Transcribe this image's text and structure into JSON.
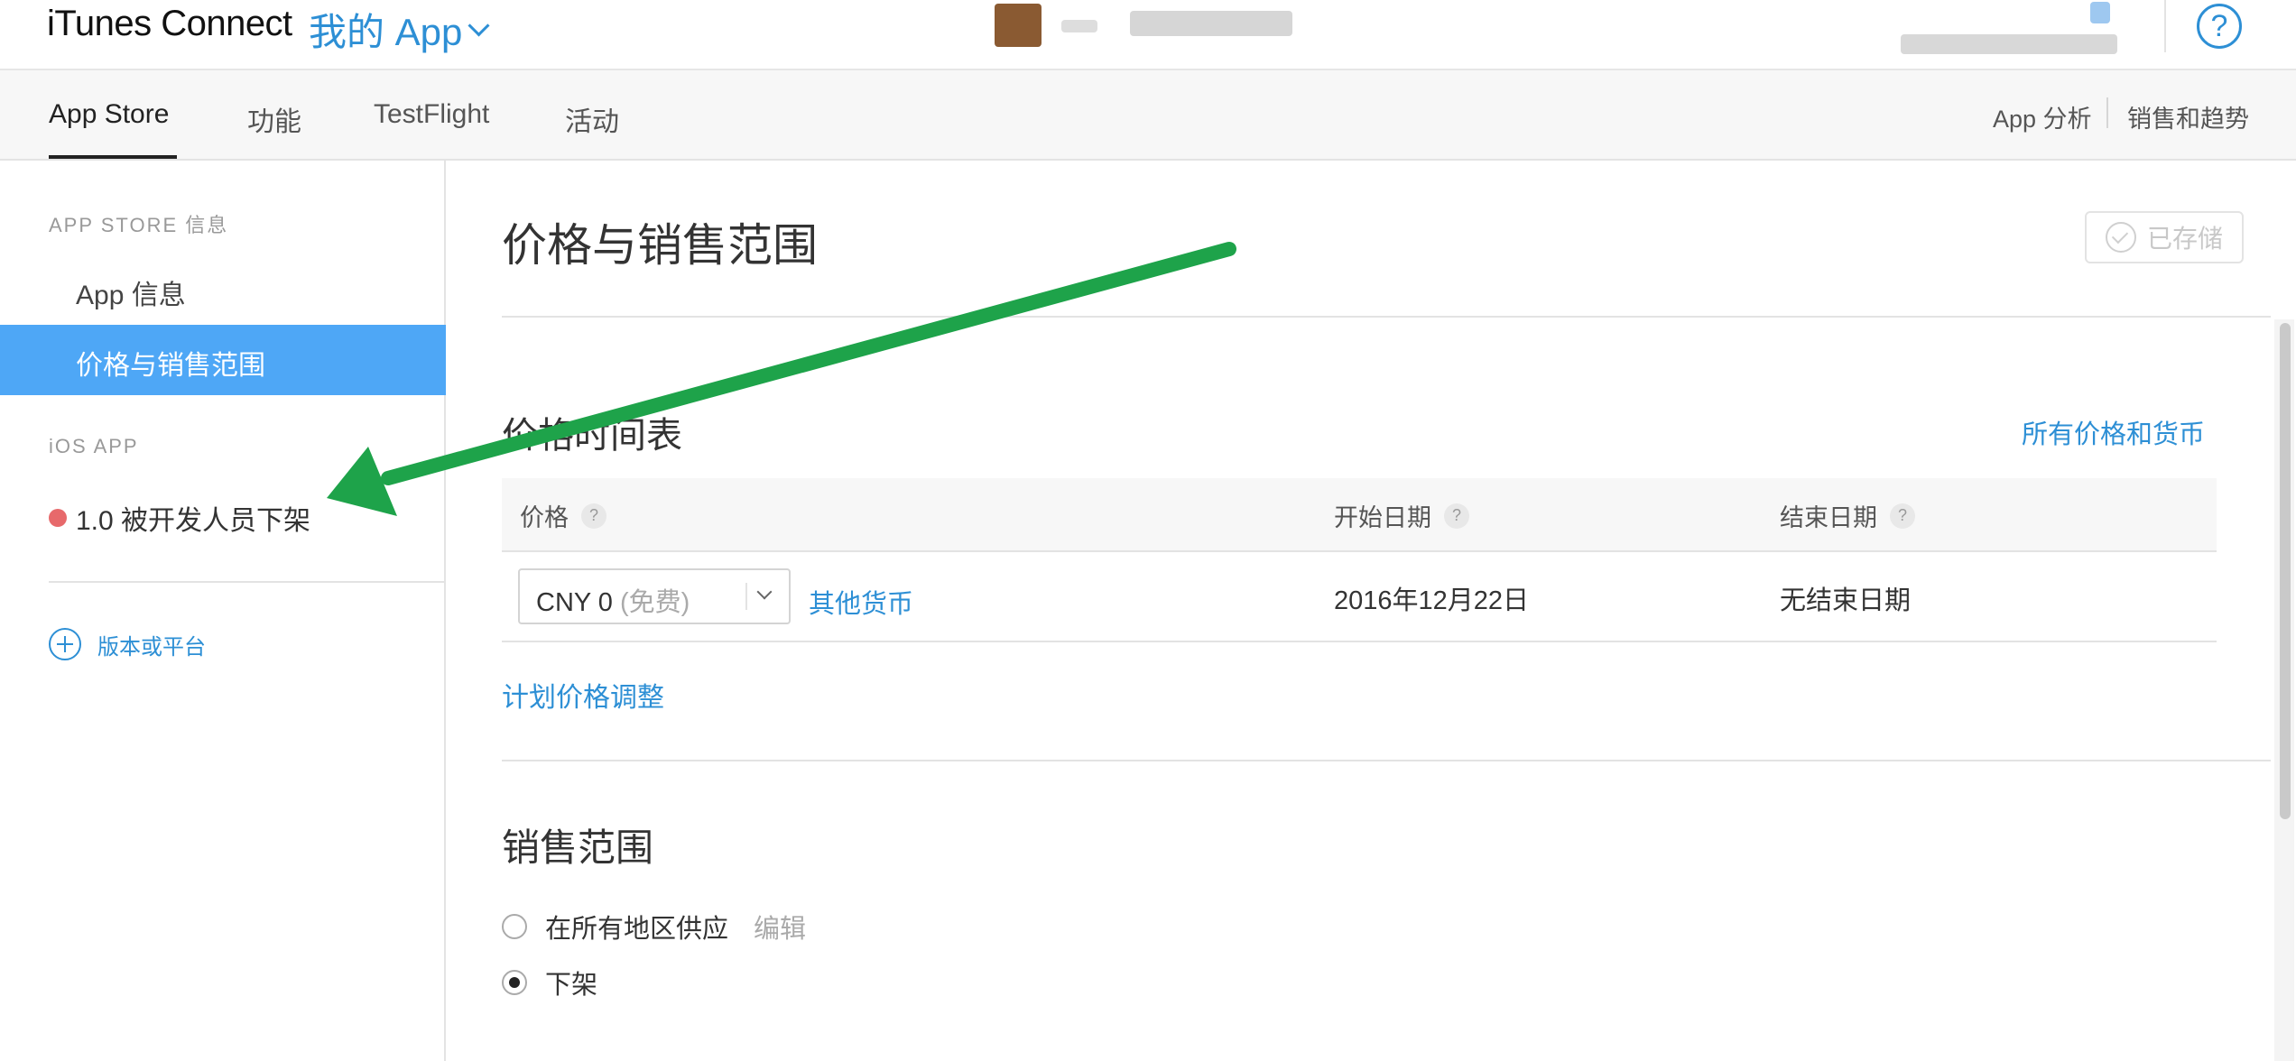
{
  "header": {
    "brand": "iTunes Connect",
    "my_apps": "我的 App",
    "help": "?"
  },
  "nav": {
    "tabs": [
      "App Store",
      "功能",
      "TestFlight",
      "活动"
    ],
    "right": [
      "App 分析",
      "销售和趋势"
    ]
  },
  "sidebar": {
    "section1": "APP STORE 信息",
    "app_info": "App 信息",
    "pricing": "价格与销售范围",
    "section2": "iOS APP",
    "version": "1.0 被开发人员下架",
    "add_version": "版本或平台"
  },
  "main": {
    "title": "价格与销售范围",
    "saved": "已存储",
    "schedule_title": "价格时间表",
    "all_prices": "所有价格和货币",
    "columns": {
      "price": "价格",
      "start": "开始日期",
      "end": "结束日期"
    },
    "row": {
      "price_value": "CNY 0",
      "price_note": "(免费)",
      "other_currency": "其他货币",
      "start_date": "2016年12月22日",
      "end_date": "无结束日期"
    },
    "plan_price": "计划价格调整",
    "availability_title": "销售范围",
    "option_all": "在所有地区供应",
    "option_all_edit": "编辑",
    "option_remove": "下架"
  },
  "colors": {
    "accent": "#2d8fd5",
    "active_sidebar": "#4ea7f6",
    "status_dot": "#e7696b",
    "arrow": "#1ea34a"
  }
}
